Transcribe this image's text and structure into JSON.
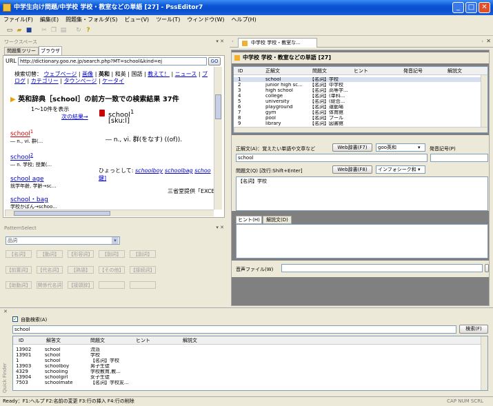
{
  "window": {
    "title": "中学生向け問題/中学校 学校・教室などの単語 [27] - PssEditor7"
  },
  "menu": [
    "ファイル(F)",
    "編集(E)",
    "問題集・フォルダ(S)",
    "ビュー(V)",
    "ツール(T)",
    "ウィンドウ(W)",
    "ヘルプ(H)"
  ],
  "workspace": {
    "title": "ワークスペース",
    "tabs": [
      "問題集ツリー",
      "ブラウザ"
    ],
    "url_label": "URL",
    "url": "http://dictionary.goo.ne.jp/search.php?MT=school&kind=ej",
    "go": "GO",
    "search_label": "検索切替：",
    "search_links": [
      "ウェブページ",
      "画像",
      "英和",
      "和英",
      "国語",
      "教えて！",
      "ニュース",
      "ブログ",
      "カテゴリー",
      "タウンページ",
      "ケータイ"
    ],
    "result_heading": "英和辞典［school］の前方一致での検索結果 37件",
    "result_count": "1〜10件を表示",
    "next": "次の結果→",
    "entries": [
      {
        "word": "school",
        "sup": "1",
        "desc": "― n., vi. 群(..."
      },
      {
        "word": "school",
        "sup": "2",
        "desc": "― n. 学校; 授業(..."
      },
      {
        "word": "school age",
        "sup": "",
        "desc": "就学年齢, 学齢→sc..."
      },
      {
        "word": "school・bag",
        "sup": "",
        "desc": "学校かばん→schoo..."
      }
    ],
    "detail_word": "school",
    "detail_sup": "1",
    "detail_pron": "[skuːl]",
    "detail_def": "― n., vi. 群(をなす) ((of)).",
    "hyotto": "ひょっとして:",
    "hyotto_links": [
      "schoolboy",
      "schoolbag",
      "schoo"
    ],
    "hyotto_tail": "鍵]",
    "provider": "三省堂提供「EXCE"
  },
  "pattern": {
    "title": "PatternSelect",
    "selected": "品詞",
    "buttons": [
      "【名詞】",
      "【動詞】",
      "【形容詞】",
      "【副詞】",
      "【副詞】",
      "【前置詞】",
      "【代名詞】",
      "【熟語】",
      "【その他】",
      "【接続詞】",
      "【助動詞】",
      "関係代名詞",
      "【接頭辞】"
    ]
  },
  "doc": {
    "tab": "中学校 学校・教室な...",
    "title": "中学校 学校・教室などの単語 [27]",
    "columns": [
      "ID",
      "正解文",
      "問題文",
      "ヒント",
      "発音記号",
      "解説文"
    ],
    "rows": [
      [
        "1",
        "school",
        "【名詞】学校"
      ],
      [
        "2",
        "junior high sc...",
        "【名詞】中学校"
      ],
      [
        "3",
        "high school",
        "【名詞】高等学..."
      ],
      [
        "4",
        "college",
        "【名詞】(単科..."
      ],
      [
        "5",
        "university",
        "【名詞】(総合..."
      ],
      [
        "6",
        "playground",
        "【名詞】運動場"
      ],
      [
        "7",
        "gym",
        "【名詞】体育館"
      ],
      [
        "8",
        "pool",
        "【名詞】プール"
      ],
      [
        "9",
        "library",
        "【名詞】図書館"
      ]
    ],
    "answer_label": "正解文(A)：覚えたい単語や文章など",
    "web_f7": "Web辞書(F7)",
    "dict_select": "goo英和",
    "pron_label": "発音記号(P)",
    "answer_value": "school",
    "question_label": "問題文(Q) [改行:Shift+Enter]",
    "web_f8": "Web辞書(F8)",
    "seek_select": "インフォシーク和",
    "question_value": "【名詞】学校",
    "tabs2": [
      "ヒント(H)",
      "解説文(D)"
    ],
    "audio_label": "音声ファイル(W)"
  },
  "finder": {
    "side_label": "Quick Finder",
    "auto_label": "自動検索(A)",
    "query": "school",
    "search_button": "検索(F)",
    "columns": [
      "ID",
      "解答文",
      "問題文",
      "ヒント",
      "解説文"
    ],
    "rows": [
      [
        "13902",
        "school",
        "流派"
      ],
      [
        "13901",
        "school",
        "学校"
      ],
      [
        "1",
        "school",
        "【名詞】学校"
      ],
      [
        "13903",
        "schoolboy",
        "男子生徒"
      ],
      [
        "4329",
        "schooling",
        "学校教育,教..."
      ],
      [
        "13904",
        "schoolgirl",
        "女子生徒"
      ],
      [
        "7503",
        "schoolmate",
        "【名詞】学校友..."
      ]
    ]
  },
  "status": {
    "left": "Ready：F1:ヘルプ F2:名前の変更 F3:行の挿入 F4:行の削除",
    "right": "CAP NUM SCRL"
  },
  "colors": {
    "title_blue": "#0a53d4",
    "link": "#0000cc",
    "header_pane": "#808080"
  }
}
